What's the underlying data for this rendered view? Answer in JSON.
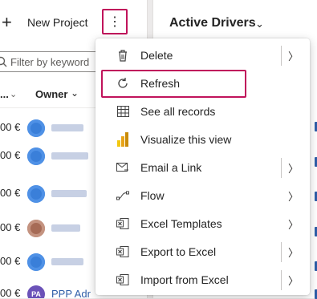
{
  "commandbar": {
    "new_project_label": "New Project",
    "more_icon": "⋮"
  },
  "filter": {
    "placeholder": "Filter by keyword"
  },
  "grid": {
    "prev_column_label": "...",
    "owner_column_label": "Owner",
    "rows": [
      {
        "amount": "00 €",
        "avatar_initials": "",
        "owner": ""
      },
      {
        "amount": "00 €",
        "avatar_initials": "",
        "owner": ""
      },
      {
        "amount": "00 €",
        "avatar_initials": "",
        "owner": ""
      },
      {
        "amount": "00 €",
        "avatar_initials": "",
        "owner": ""
      },
      {
        "amount": "00 €",
        "avatar_initials": "",
        "owner": ""
      },
      {
        "amount": "00 €",
        "avatar_initials": "PA",
        "owner": "PPP Adr"
      }
    ]
  },
  "right_panel": {
    "title": "Active Drivers",
    "chevron": "⌄"
  },
  "menu": {
    "items": [
      {
        "label": "Delete",
        "icon": "trash-icon",
        "split": true,
        "arrow": "〉"
      },
      {
        "label": "Refresh",
        "icon": "refresh-icon",
        "highlighted": true
      },
      {
        "label": "See all records",
        "icon": "grid-icon"
      },
      {
        "label": "Visualize this view",
        "icon": "chart-icon"
      },
      {
        "label": "Email a Link",
        "icon": "email-link-icon",
        "split": true,
        "arrow": "〉"
      },
      {
        "label": "Flow",
        "icon": "flow-icon",
        "arrow": "〉"
      },
      {
        "label": "Excel Templates",
        "icon": "excel-icon",
        "arrow": "〉"
      },
      {
        "label": "Export to Excel",
        "icon": "excel-export-icon",
        "split": true,
        "arrow": "〉"
      },
      {
        "label": "Import from Excel",
        "icon": "excel-import-icon",
        "split": true,
        "arrow": "〉"
      }
    ]
  },
  "colors": {
    "highlight": "#c0135b",
    "link": "#2f5ea8",
    "avatar_blue": "#3a7fd9",
    "chart_gold": "#f2c811"
  }
}
